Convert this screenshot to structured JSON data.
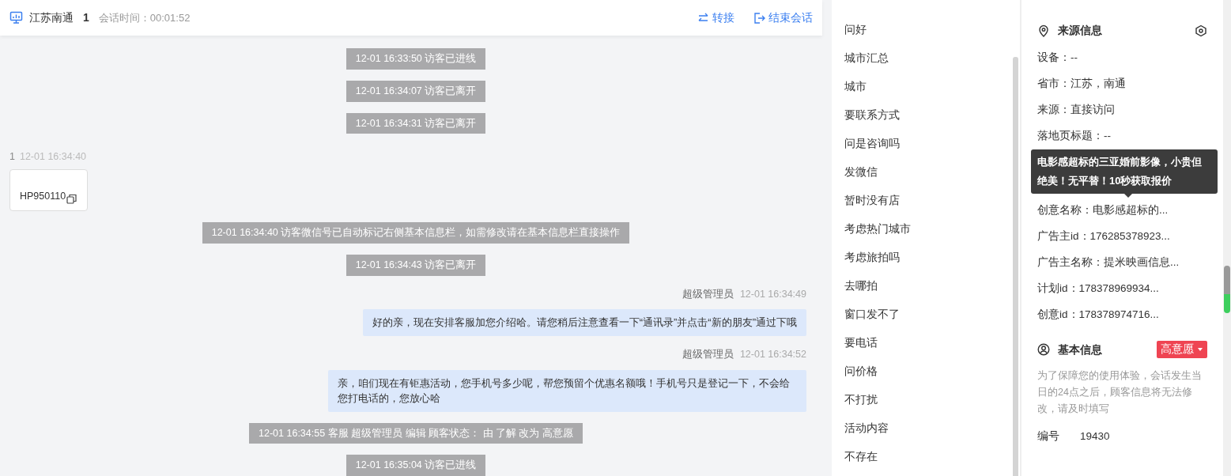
{
  "header": {
    "title": "江苏南通",
    "count": "1",
    "duration": "会话时间：00:01:52",
    "actions": [
      {
        "kind": "transfer",
        "label": "转接"
      },
      {
        "kind": "end",
        "label": "结束会话"
      }
    ]
  },
  "messages": [
    {
      "kind": "system",
      "text": "12-01 16:33:50 访客已进线"
    },
    {
      "kind": "system",
      "text": "12-01 16:34:07 访客已离开"
    },
    {
      "kind": "system",
      "text": "12-01 16:34:31 访客已离开"
    },
    {
      "kind": "visitor",
      "sender": "1",
      "time": "12-01 16:34:40",
      "text": "HP950110"
    },
    {
      "kind": "system",
      "text": "12-01 16:34:40 访客微信号已自动标记右侧基本信息栏，如需修改请在基本信息栏直接操作"
    },
    {
      "kind": "system",
      "text": "12-01 16:34:43 访客已离开"
    },
    {
      "kind": "agent",
      "sender": "超级管理员",
      "time": "12-01 16:34:49",
      "text": "好的亲，现在安排客服加您介绍哈。请您稍后注意查看一下“通讯录”并点击“新的朋友”通过下哦"
    },
    {
      "kind": "agent",
      "sender": "超级管理员",
      "time": "12-01 16:34:52",
      "text": "亲，咱们现在有钜惠活动，您手机号多少呢，帮您预留个优惠名额哦！手机号只是登记一下，不会给您打电话的，您放心哈"
    },
    {
      "kind": "system",
      "text": "12-01 16:34:55 客服 超级管理员 编辑 顾客状态： 由 了解 改为 高意愿"
    },
    {
      "kind": "system",
      "text": "12-01 16:35:04 访客已进线"
    }
  ],
  "quick_replies": [
    "问好",
    "城市汇总",
    "城市",
    "要联系方式",
    "问是咨询吗",
    "发微信",
    "暂时没有店",
    "考虑热门城市",
    "考虑旅拍吗",
    "去哪拍",
    "窗口发不了",
    "要电话",
    "问价格",
    "不打扰",
    "活动内容",
    "不存在"
  ],
  "source_info": {
    "title": "来源信息",
    "rows": [
      {
        "kind": "field",
        "text": "设备：--"
      },
      {
        "kind": "field",
        "text": "省市：江苏，南通"
      },
      {
        "kind": "field",
        "text": "来源：直接访问"
      },
      {
        "kind": "field",
        "text": "落地页标题：--"
      },
      {
        "kind": "tooltip",
        "text": "电影感超标的三亚婚前影像，小贵但绝美！无平替！10秒获取报价"
      },
      {
        "kind": "field",
        "text": "创意名称：电影感超标的..."
      },
      {
        "kind": "field",
        "text": "广告主id：176285378923..."
      },
      {
        "kind": "field",
        "text": "广告主名称：提米映画信息..."
      },
      {
        "kind": "field",
        "text": "计划id：178378969934..."
      },
      {
        "kind": "field",
        "text": "创意id：178378974716..."
      }
    ]
  },
  "basic_info": {
    "title": "基本信息",
    "intent": {
      "label": "高意愿",
      "color": "#ef4452"
    },
    "notice": "为了保障您的使用体验，会话发生当日的24点之后，顾客信息将无法修改，请及时填写",
    "fields": [
      {
        "label": "编号",
        "value": "19430"
      }
    ]
  }
}
